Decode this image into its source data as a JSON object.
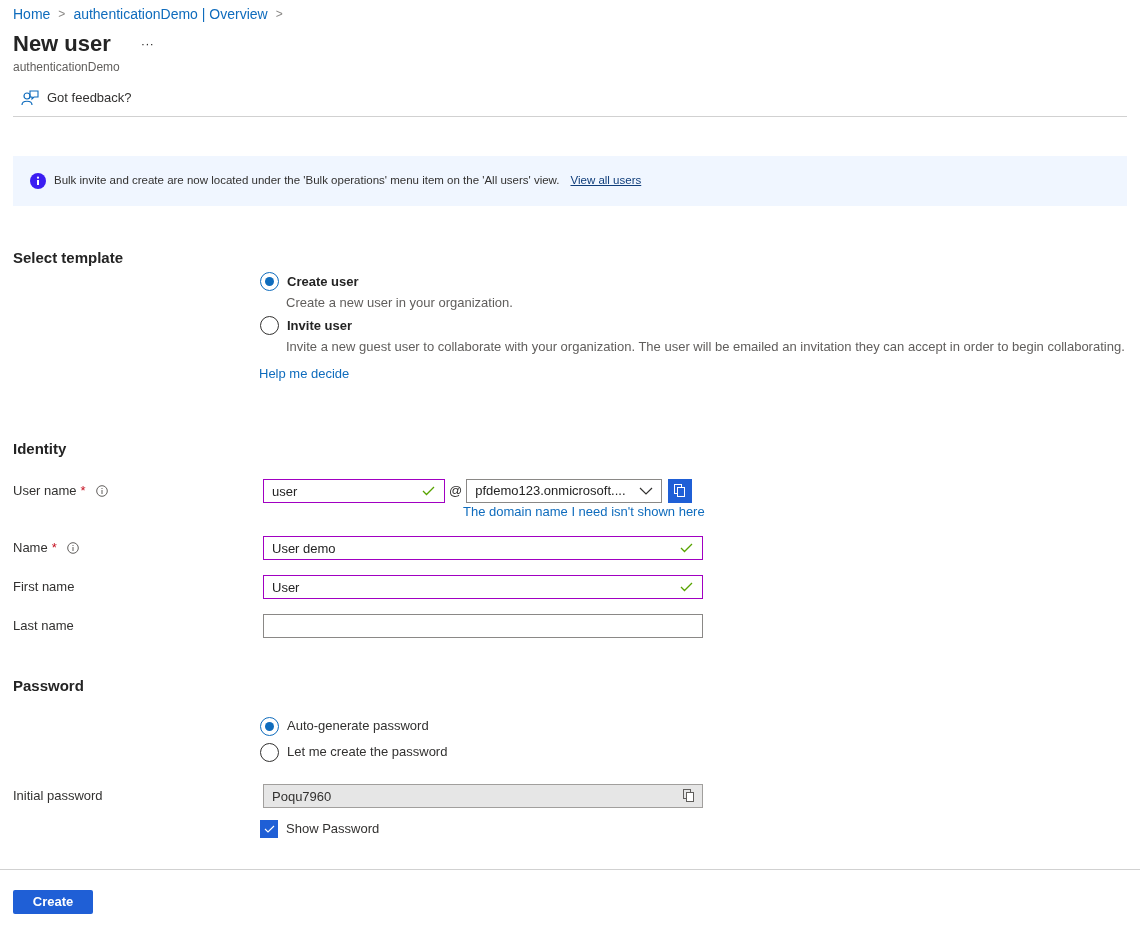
{
  "breadcrumb": [
    {
      "label": "Home"
    },
    {
      "label": "authenticationDemo | Overview"
    }
  ],
  "breadcrumb_separator": ">",
  "title": "New user",
  "more": "···",
  "subtitle": "authenticationDemo",
  "toolbar": {
    "label": "Got feedback?"
  },
  "banner": {
    "text": "Bulk invite and create are now located under the 'Bulk operations' menu item on the 'All users' view.",
    "link": "View all users"
  },
  "template": {
    "heading": "Select template",
    "options": [
      {
        "label": "Create user",
        "description": "Create a new user in your organization.",
        "selected": true
      },
      {
        "label": "Invite user",
        "description": "Invite a new guest user to collaborate with your organization. The user will be emailed an invitation they can accept in order to begin collaborating.",
        "selected": false
      }
    ],
    "help_link": "Help me decide"
  },
  "identity": {
    "heading": "Identity",
    "fields": [
      {
        "kind": "username",
        "label": "User name",
        "required_mark": "*",
        "info": true,
        "value": "user",
        "valid": true,
        "at": "@",
        "domain": "pfdemo123.onmicrosoft....",
        "domain_link": "The domain name I need isn't shown here"
      },
      {
        "kind": "text",
        "label": "Name",
        "required_mark": "*",
        "info": true,
        "value": "User demo",
        "valid": true
      },
      {
        "kind": "text",
        "label": "First name",
        "value": "User",
        "valid": true
      },
      {
        "kind": "text",
        "label": "Last name",
        "valid": false
      }
    ]
  },
  "password": {
    "heading": "Password",
    "options": [
      {
        "label": "Auto-generate password",
        "selected": true
      },
      {
        "label": "Let me create the password",
        "selected": false
      }
    ],
    "initial_password": {
      "label": "Initial password",
      "value": "Poqu7960",
      "disabled": true
    },
    "show_password": {
      "label": "Show Password",
      "checked": true
    }
  },
  "create_button": "Create"
}
